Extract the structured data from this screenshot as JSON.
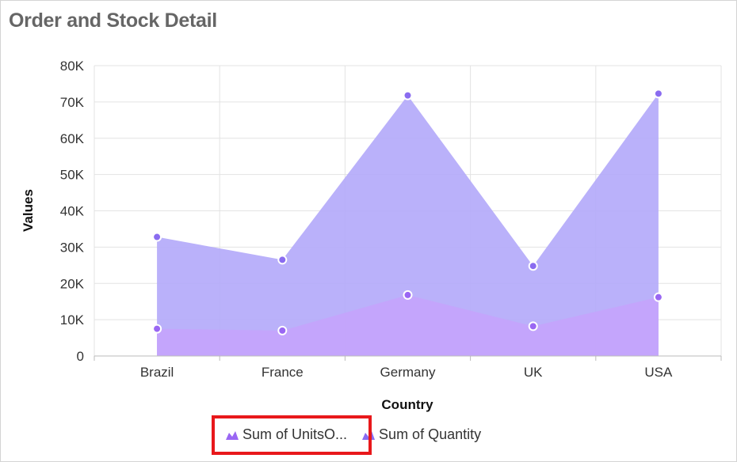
{
  "widget": {
    "title": "Order and Stock Detail"
  },
  "chart_data": {
    "type": "area",
    "title": "Order and Stock Detail",
    "xlabel": "Country",
    "ylabel": "Values",
    "categories": [
      "Brazil",
      "France",
      "Germany",
      "UK",
      "USA"
    ],
    "ylim": [
      0,
      80000
    ],
    "yticks": [
      0,
      10000,
      20000,
      30000,
      40000,
      50000,
      60000,
      70000,
      80000
    ],
    "ytick_labels": [
      "0",
      "10K",
      "20K",
      "30K",
      "40K",
      "50K",
      "60K",
      "70K",
      "80K"
    ],
    "grid": true,
    "legend_position": "bottom",
    "series": [
      {
        "name": "Sum of Quantity",
        "color": "#b3a9f9",
        "marker": "#8a6cf0",
        "values": [
          32800,
          26500,
          71800,
          24800,
          72300
        ]
      },
      {
        "name": "Sum of UnitsO...",
        "color": "#c6a3fb",
        "marker": "#9a67f3",
        "values": [
          7500,
          7000,
          16800,
          8200,
          16200
        ]
      }
    ]
  },
  "legend": {
    "items": [
      "Sum of UnitsO...",
      "Sum of Quantity"
    ],
    "colors": [
      "#9a67f3",
      "#8a6cf0"
    ]
  }
}
